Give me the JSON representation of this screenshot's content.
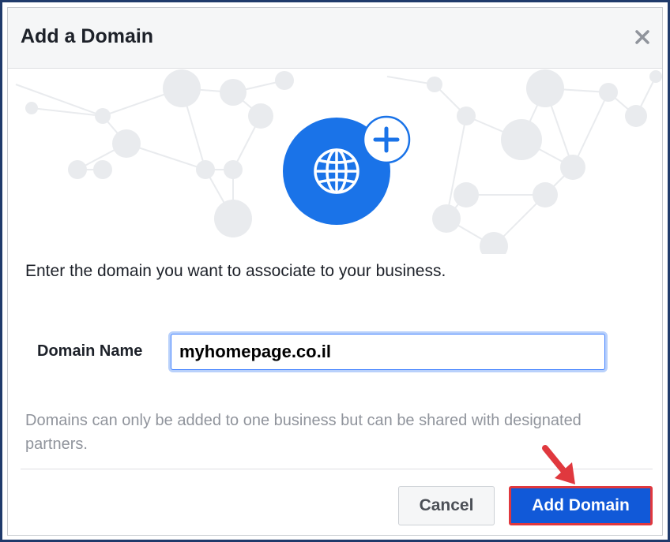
{
  "dialog": {
    "title": "Add a Domain",
    "close_icon": "close-icon"
  },
  "hero": {
    "globe_icon": "globe-icon",
    "plus_icon": "plus-icon",
    "accent_color": "#1a73e8"
  },
  "form": {
    "prompt": "Enter the domain you want to associate to your business.",
    "domain_label": "Domain Name",
    "domain_value": "myhomepage.co.il",
    "note": "Domains can only be added to one business but can be shared with designated partners."
  },
  "footer": {
    "cancel_label": "Cancel",
    "add_label": "Add Domain",
    "add_color": "#1159d8",
    "highlight_color": "#e0383e"
  }
}
